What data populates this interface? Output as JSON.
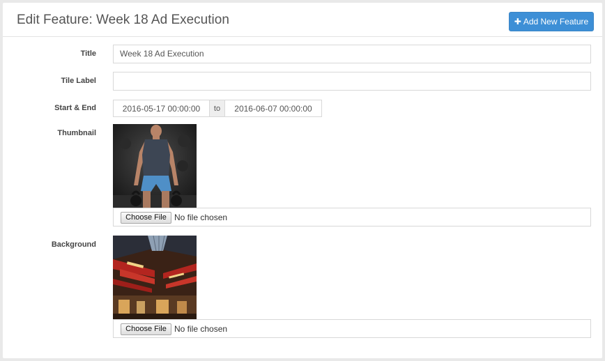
{
  "header": {
    "title": "Edit Feature: Week 18 Ad Execution",
    "add_button": {
      "icon": "plus-icon",
      "label": "Add New Feature"
    }
  },
  "form": {
    "title": {
      "label": "Title",
      "value": "Week 18 Ad Execution"
    },
    "tile_label": {
      "label": "Tile Label",
      "value": ""
    },
    "start_end": {
      "label": "Start & End",
      "start": "2016-05-17 00:00:00",
      "separator": "to",
      "end": "2016-06-07 00:00:00"
    },
    "thumbnail": {
      "label": "Thumbnail",
      "choose_label": "Choose File",
      "file_status": "No file chosen"
    },
    "background": {
      "label": "Background",
      "choose_label": "Choose File",
      "file_status": "No file chosen"
    }
  },
  "colors": {
    "accent": "#3d8fd6",
    "page_bg": "#e9e9e9",
    "panel_bg": "#ffffff"
  }
}
